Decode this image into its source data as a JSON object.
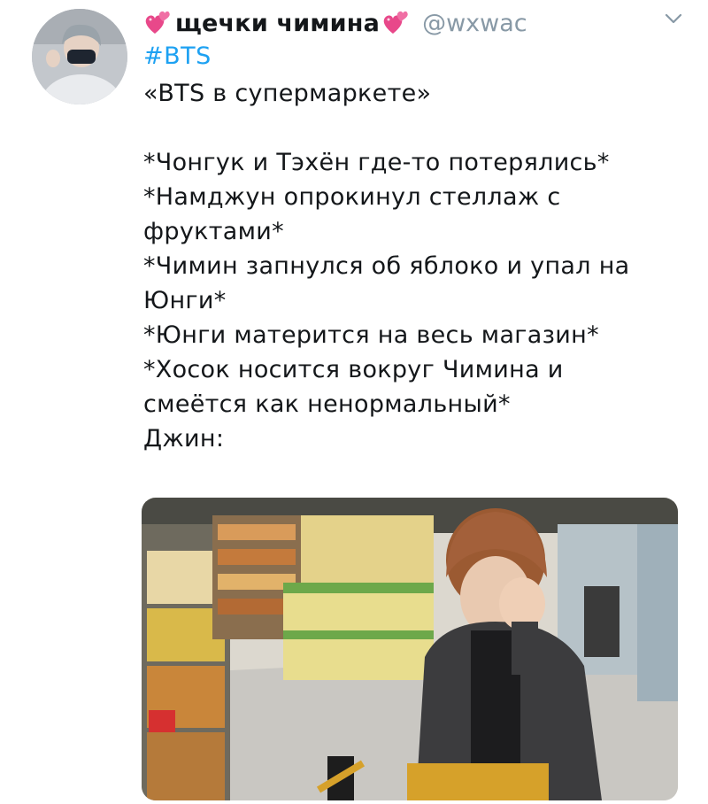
{
  "tweet": {
    "display_name": "щечки чимина",
    "handle": "@wxwac",
    "hashtag": "#BTS",
    "lines": [
      "«BTS в супермаркете»",
      "",
      "*Чонгук и Тэхён где-то потерялись*",
      "*Намджун опрокинул стеллаж с",
      "фруктами*",
      "*Чимин запнулся об яблоко и упал на",
      "Юнги*",
      "*Юнги матерится на весь магазин*",
      "*Хосок носится вокруг Чимина и",
      "смеётся как ненормальный*",
      "Джин:"
    ],
    "name_decoration": "heart-emoji",
    "menu_icon": "chevron-down-icon"
  },
  "colors": {
    "link": "#1da1f2",
    "muted": "#8899a6",
    "text": "#14171a",
    "heart": "#e8488a"
  }
}
